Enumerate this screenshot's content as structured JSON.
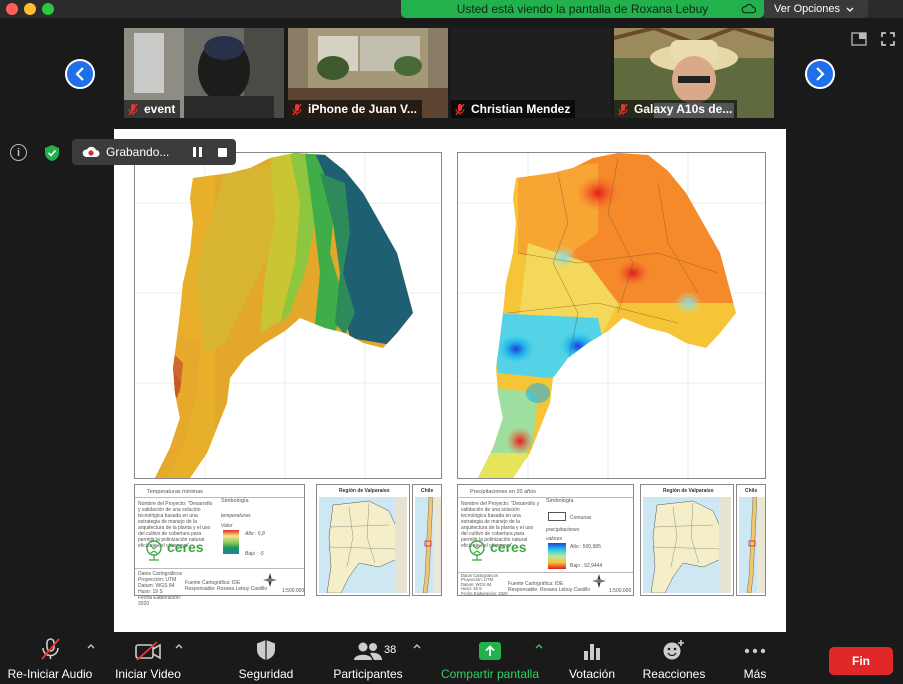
{
  "banner": {
    "text": "Usted está viendo la pantalla de Roxana Lebuy",
    "view_options": "Ver Opciones"
  },
  "participants": [
    {
      "name": "event"
    },
    {
      "name": "iPhone de Juan V..."
    },
    {
      "name": "Christian Mendez"
    },
    {
      "name": "Galaxy A10s de..."
    }
  ],
  "recording": {
    "label": "Grabando..."
  },
  "slide": {
    "left_map": {
      "legend_title": "Temperaturas mínimas",
      "symbology": "Simbología",
      "legend_sub": "temperaturas",
      "value_label": "Valor",
      "high": "Alto : 6,8",
      "low": "Bajo : -5",
      "project_text": "Nombre del Proyecto: \"Desarrollo y validación de una solución tecnológica basada en una estrategia de manejo de la arquitectura de la planta y el uso del cultivo de cobertura para permitir la polinización natural eficiente del chirimoyo\"",
      "data_text": "Datos Cartográficos\nProyección: UTM\nDatum: WGS 84\nHuso: 19 S\nFecha Elaboración: 2020",
      "source": "Fuente Cartográfica: IDE",
      "responsible": "Responsable: Roxana Lebuy Castillo",
      "scale": "1:500.000"
    },
    "right_map": {
      "legend_title": "Precipitaciones en 20 años",
      "symbology": "Simbología",
      "comunas": "Comunas",
      "legend_sub": "precipitaciones",
      "value_label": "valores",
      "high": "Alto : 500,985",
      "low": "Bajo : 92,9444",
      "project_text": "Nombre del Proyecto: \"Desarrollo y validación de una solución tecnológica basada en una estrategia de manejo de la arquitectura de la planta y el uso del cultivo de cobertura para permitir la polinización natural eficiente del chirimoyo\"",
      "data_text": "Datos Cartográficos\nProyección: UTM\nDatum: WGS 84\nHuso: 19 S\nFecha Elaboración: 2020",
      "source": "Fuente Cartográfica: IDE",
      "responsible": "Responsable: Roxana Lebuy Castillo",
      "scale": "1:500.000"
    },
    "brand": "ceres",
    "inset_region": "Región de Valparaíso",
    "inset_country": "Chile"
  },
  "controls": {
    "audio": "Re-Iniciar Audio",
    "video": "Iniciar Video",
    "security": "Seguridad",
    "participants": "Participantes",
    "participant_count": "38",
    "share": "Compartir pantalla",
    "poll": "Votación",
    "reactions": "Reacciones",
    "more": "Más",
    "end": "Fin"
  },
  "colors": {
    "share_green": "#23b14d",
    "end_red": "#e02828",
    "nav_blue": "#1f6feb"
  }
}
